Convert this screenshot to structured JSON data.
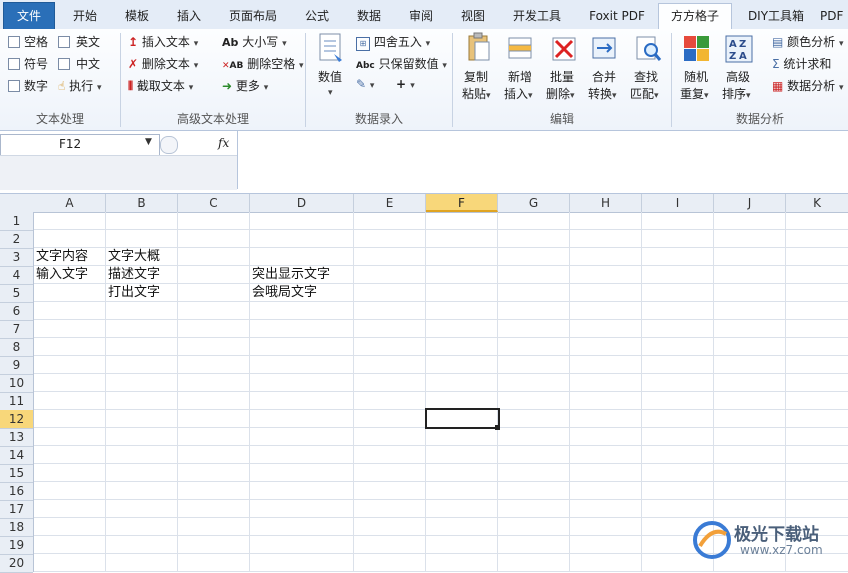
{
  "tabs": [
    "文件",
    "开始",
    "模板",
    "插入",
    "页面布局",
    "公式",
    "数据",
    "审阅",
    "视图",
    "开发工具",
    "Foxit PDF",
    "方方格子",
    "DIY工具箱",
    "PDF"
  ],
  "ribbon": {
    "text_group": {
      "checks": [
        "空格",
        "英文",
        "符号",
        "中文",
        "数字"
      ],
      "run": "执行",
      "label": "文本处理"
    },
    "adv_group": {
      "insert": "插入文本",
      "delete": "删除文本",
      "extract": "截取文本",
      "case": "大小写",
      "delspace": "删除空格",
      "more": "更多",
      "label": "高级文本处理"
    },
    "entry_group": {
      "value": "数值",
      "round": "四舍五入",
      "keep": "只保留数值",
      "plus": "+",
      "label": "数据录入"
    },
    "edit_group": {
      "copy": [
        "复制",
        "粘贴"
      ],
      "insert": [
        "新增",
        "插入"
      ],
      "batch": [
        "批量",
        "删除"
      ],
      "merge": [
        "合并",
        "转换"
      ],
      "find": [
        "查找",
        "匹配"
      ],
      "label": "编辑"
    },
    "analysis_group": {
      "random": [
        "随机",
        "重复"
      ],
      "sort": [
        "高级",
        "排序"
      ],
      "color": "颜色分析",
      "sum": "统计求和",
      "data": "数据分析",
      "label": "数据分析"
    }
  },
  "formula_bar": {
    "name_box": "F12",
    "fx": "fx",
    "content": ""
  },
  "columns": [
    "A",
    "B",
    "C",
    "D",
    "E",
    "F",
    "G",
    "H",
    "I",
    "J",
    "K"
  ],
  "rows": [
    "1",
    "2",
    "3",
    "4",
    "5",
    "6",
    "7",
    "8",
    "9",
    "10",
    "11",
    "12",
    "13",
    "14",
    "15",
    "16",
    "17",
    "18",
    "19",
    "20"
  ],
  "selected": {
    "column": "F",
    "row": "12"
  },
  "cells": {
    "A3": "文字内容",
    "B3": "文字大概",
    "A4": "输入文字",
    "B4": "描述文字",
    "D4": "突出显示文字",
    "B5": "打出文字",
    "D5": "会哦局文字"
  },
  "watermark": {
    "name": "极光下载站",
    "url": "www.xz7.com"
  }
}
